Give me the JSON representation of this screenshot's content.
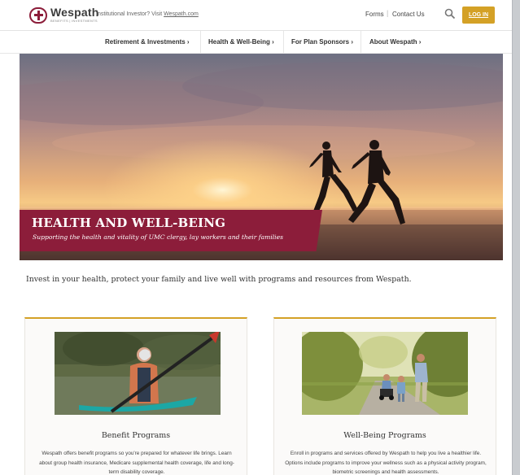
{
  "header": {
    "logo_text": "Wespath",
    "logo_tagline": "BENEFITS | INVESTMENTS",
    "institutional_prefix": "Institutional Investor? Visit ",
    "institutional_link": "Wespath.com",
    "forms_label": "Forms",
    "separator": "|",
    "contact_label": "Contact Us",
    "search_icon": "search-icon",
    "login_label": "LOG IN",
    "login_color": "#d4a126"
  },
  "nav": {
    "items": [
      {
        "label": "Retirement & Investments ›"
      },
      {
        "label": "Health & Well-Being ›"
      },
      {
        "label": "For Plan Sponsors ›"
      },
      {
        "label": "About Wespath ›"
      }
    ]
  },
  "hero": {
    "title": "HEALTH AND WELL-BEING",
    "subtitle": "Supporting the health and vitality of UMC clergy, lay workers and their families",
    "band_color": "#8c1d3a"
  },
  "intro": "Invest in your health, protect your family and live well with programs and resources from Wespath.",
  "cards": [
    {
      "title": "Benefit Programs",
      "body": "Wespath offers benefit programs so you're prepared for whatever life brings. Learn about group health insurance, Medicare supplemental health coverage, life and long-term disability coverage."
    },
    {
      "title": "Well-Being Programs",
      "body": "Enroll in programs and services offered by Wespath to help you live a healthier life. Options include programs to improve your wellness such as a physical activity program, biometric screenings and health assessments."
    }
  ],
  "accent_color": "#d4a126"
}
